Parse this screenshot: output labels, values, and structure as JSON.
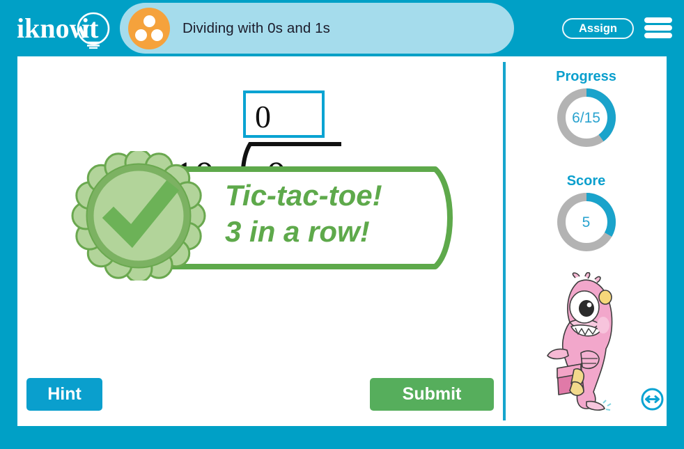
{
  "header": {
    "logo_text": "iknowit",
    "logo_icon": "lightbulb-icon",
    "topic_icon": "three-dots-icon",
    "topic_title": "Dividing with 0s and 1s",
    "assign_label": "Assign",
    "menu_icon": "hamburger-menu-icon"
  },
  "problem": {
    "answer_value": "0",
    "dividend": "10",
    "quotient_digit": "0",
    "bracket_icon": "long-division-bracket-icon"
  },
  "feedback": {
    "badge_icon": "check-rosette-icon",
    "line1": "Tic-tac-toe!",
    "line2": "3 in a row!"
  },
  "actions": {
    "hint_label": "Hint",
    "submit_label": "Submit"
  },
  "sidebar": {
    "progress_label": "Progress",
    "progress_value": "6/15",
    "progress_fraction": 0.4,
    "score_label": "Score",
    "score_value": "5",
    "score_fraction": 0.333,
    "mascot_icon": "pink-monster-mascot-icon",
    "next_icon": "left-right-arrow-icon"
  },
  "colors": {
    "brand_blue": "#00a0c6",
    "pill_blue": "#a5dcec",
    "orange": "#f5a23c",
    "green": "#5ea94b",
    "submit_green": "#56ae5c",
    "ring_track": "#b3b3b3",
    "ring_fill": "#1aa3cb"
  }
}
